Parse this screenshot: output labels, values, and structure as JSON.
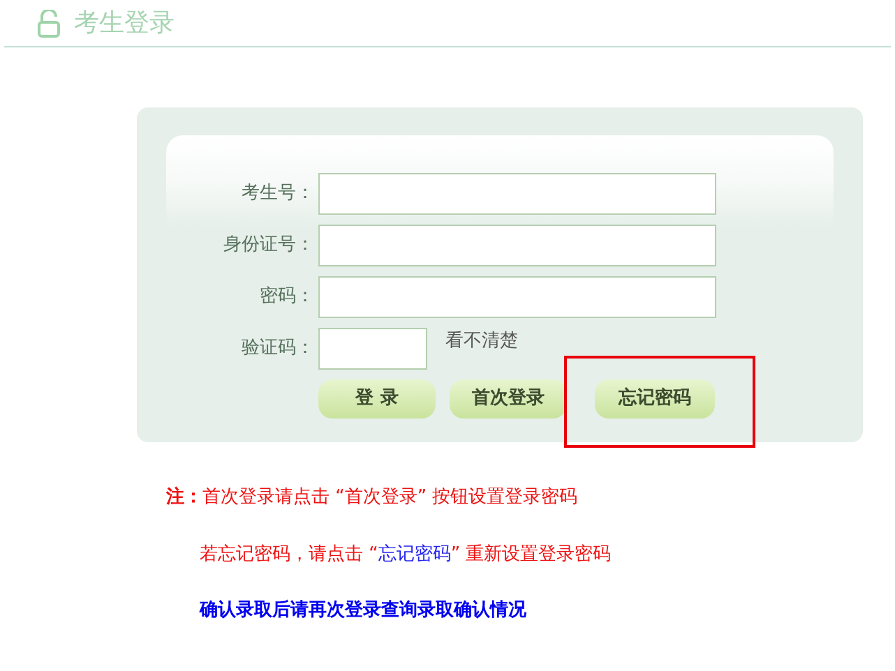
{
  "header": {
    "title": "考生登录"
  },
  "form": {
    "fields": [
      {
        "kind": "text",
        "label": "考生号："
      },
      {
        "kind": "text",
        "label": "身份证号："
      },
      {
        "kind": "password",
        "label": "密码："
      },
      {
        "kind": "captcha",
        "label": "验证码：",
        "hint": "看不清楚"
      }
    ],
    "buttons": [
      {
        "label": "登 录",
        "highlighted": false
      },
      {
        "label": "首次登录",
        "highlighted": false
      },
      {
        "label": "忘记密码",
        "highlighted": true
      }
    ]
  },
  "notes": [
    {
      "kind": "warning",
      "segments": [
        {
          "text": "**注：**首次登录请点击 “首次登录” 按钮设置登录密码",
          "kind": "normal"
        }
      ]
    },
    {
      "kind": "warning",
      "segments": [
        {
          "text": "若忘记密码，请点击 “",
          "kind": "normal"
        },
        {
          "text": "忘记密码",
          "kind": "highlight"
        },
        {
          "text": "” 重新设置登录密码",
          "kind": "normal"
        }
      ]
    },
    {
      "kind": "info",
      "segments": [
        {
          "text": "确认录取后请再次登录查询录取确认情况",
          "kind": "normal"
        }
      ]
    }
  ]
}
